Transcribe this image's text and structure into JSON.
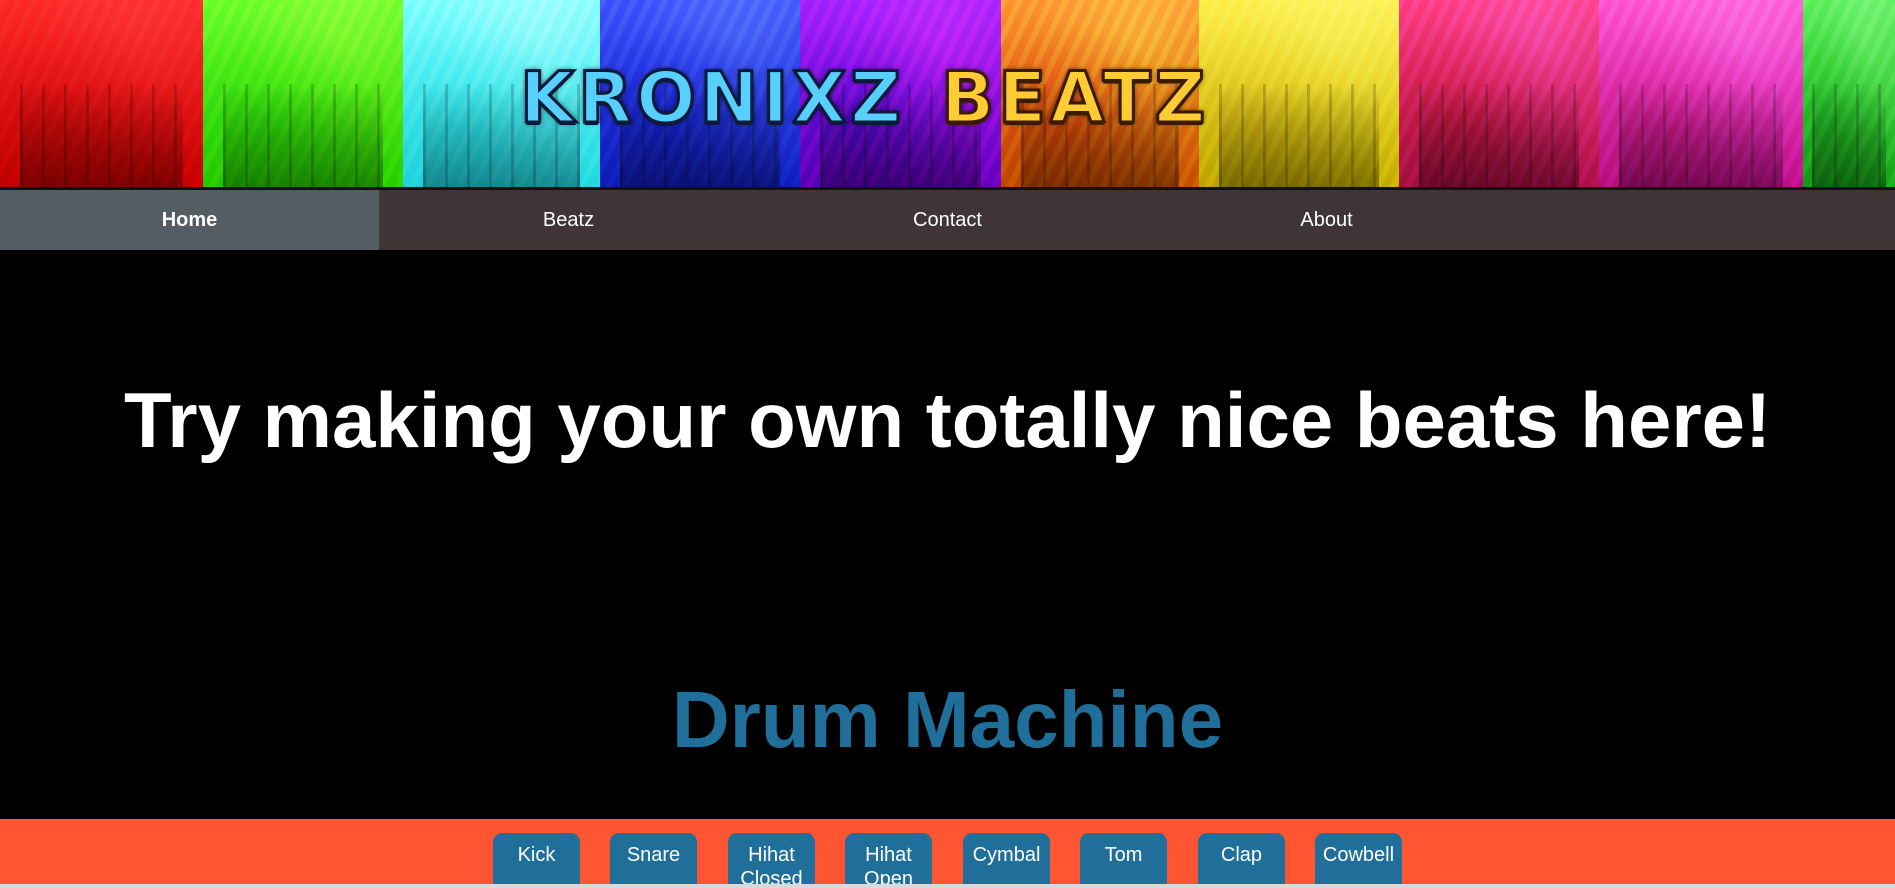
{
  "banner": {
    "title_word1": "KRONIXZ",
    "title_word2": "BEATZ",
    "colors": [
      "#ff1a1a",
      "#4dff1a",
      "#33ffff",
      "#1a33ff",
      "#9900ff",
      "#ff7a00",
      "#ffe600",
      "#e6196b",
      "#ff33cc",
      "#33e033"
    ]
  },
  "nav": {
    "items": [
      {
        "label": "Home",
        "active": true
      },
      {
        "label": "Beatz",
        "active": false
      },
      {
        "label": "Contact",
        "active": false
      },
      {
        "label": "About",
        "active": false
      }
    ]
  },
  "main": {
    "headline": "Try making your own totally nice beats here!",
    "drum_machine_title": "Drum Machine"
  },
  "pads": [
    "Kick",
    "Snare",
    "Hihat Closed",
    "Hihat Open",
    "Cymbal",
    "Tom",
    "Clap",
    "Cowbell"
  ],
  "colors": {
    "nav_bg": "#3f3537",
    "nav_active_bg": "#545d63",
    "pad_bg": "#1f6f9a",
    "strip_bg": "#ff5533",
    "dm_title": "#1f6f9a"
  }
}
